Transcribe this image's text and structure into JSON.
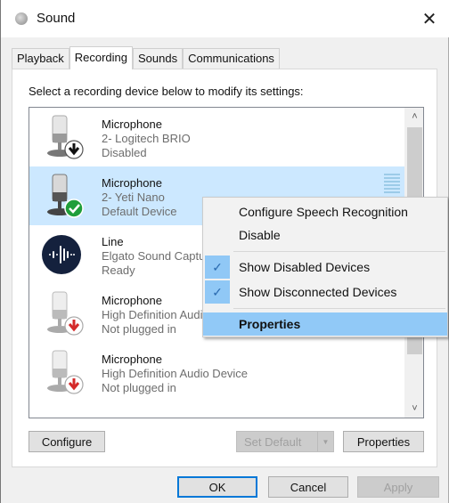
{
  "window": {
    "title": "Sound",
    "title_icon": "speaker-icon",
    "close_icon": "close-icon"
  },
  "tabs": [
    {
      "label": "Playback",
      "active": false
    },
    {
      "label": "Recording",
      "active": true
    },
    {
      "label": "Sounds",
      "active": false
    },
    {
      "label": "Communications",
      "active": false
    }
  ],
  "instruction": "Select a recording device below to modify its settings:",
  "devices": [
    {
      "name": "Microphone",
      "description": "2- Logitech BRIO",
      "status": "Disabled",
      "icon": "microphone-icon",
      "badge": "disabled-arrow-icon",
      "selected": false
    },
    {
      "name": "Microphone",
      "description": "2- Yeti Nano",
      "status": "Default Device",
      "icon": "microphone-icon",
      "badge": "default-check-icon",
      "selected": true
    },
    {
      "name": "Line",
      "description": "Elgato Sound Capture",
      "status": "Ready",
      "icon": "line-in-waveform-icon",
      "badge": "",
      "selected": false
    },
    {
      "name": "Microphone",
      "description": "High Definition Audio Device",
      "status": "Not plugged in",
      "icon": "microphone-icon",
      "badge": "unplugged-arrow-icon",
      "selected": false
    },
    {
      "name": "Microphone",
      "description": "High Definition Audio Device",
      "status": "Not plugged in",
      "icon": "microphone-icon",
      "badge": "unplugged-arrow-icon",
      "selected": false
    }
  ],
  "context_menu": {
    "items": [
      {
        "label": "Configure Speech Recognition",
        "checked": false,
        "highlighted": false
      },
      {
        "label": "Disable",
        "checked": false,
        "highlighted": false
      },
      {
        "label": "Show Disabled Devices",
        "checked": true,
        "highlighted": false
      },
      {
        "label": "Show Disconnected Devices",
        "checked": true,
        "highlighted": false
      },
      {
        "label": "Properties",
        "checked": false,
        "highlighted": true
      }
    ],
    "check_glyph": "✓"
  },
  "panel_buttons": {
    "configure": "Configure",
    "set_default": "Set Default",
    "properties": "Properties"
  },
  "dialog_buttons": {
    "ok": "OK",
    "cancel": "Cancel",
    "apply": "Apply"
  },
  "glyphs": {
    "close": "✕",
    "scroll_up": "˄",
    "scroll_down": "˅",
    "dropdown": "▼"
  },
  "colors": {
    "selection": "#cce8ff",
    "menu_highlight": "#91c9f7",
    "default_green": "#1f9e3a",
    "unplugged_red": "#d42a2a",
    "focus_blue": "#0078d7"
  }
}
